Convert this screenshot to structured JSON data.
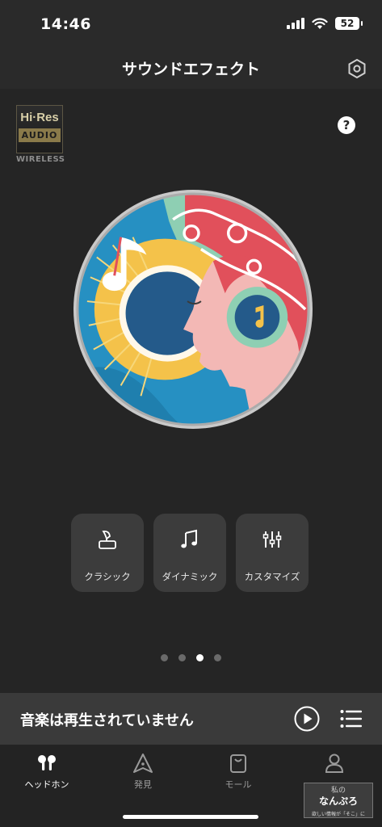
{
  "status_bar": {
    "time": "14:46",
    "battery": "52"
  },
  "nav": {
    "title": "サウンドエフェクト",
    "settings_icon": "settings-hexagon-icon"
  },
  "hires_logo": {
    "top": "Hi·Res",
    "bottom": "AUDIO",
    "sub": "WIRELESS"
  },
  "help": {
    "label": "?"
  },
  "presets": [
    {
      "label": "クラシック",
      "icon": "gramophone-icon"
    },
    {
      "label": "ダイナミック",
      "icon": "music-note-icon"
    },
    {
      "label": "カスタマイズ",
      "icon": "equalizer-sliders-icon"
    }
  ],
  "pager": {
    "count": 4,
    "active_index": 2
  },
  "player": {
    "status_text": "音楽は再生されていません",
    "play_icon": "play-circle-icon",
    "list_icon": "playlist-icon"
  },
  "tabs": [
    {
      "label": "ヘッドホン",
      "icon": "earbuds-icon",
      "active": true
    },
    {
      "label": "発見",
      "icon": "compass-icon",
      "active": false
    },
    {
      "label": "モール",
      "icon": "shopping-bag-icon",
      "active": false
    },
    {
      "label": "",
      "icon": "person-icon",
      "active": false
    }
  ],
  "watermark": {
    "top": "私の",
    "main": "なんぷろ",
    "sub": "欲しい情報が「そこ」に"
  },
  "colors": {
    "background": "#252525",
    "bar": "#2a2a2a",
    "preset_tile": "#3c3c3c",
    "player_bar": "#3a3a3a",
    "accent_red": "#e1505b",
    "accent_teal": "#8ecfb3",
    "accent_yellow": "#f4c24a",
    "accent_blue": "#2690c2"
  }
}
